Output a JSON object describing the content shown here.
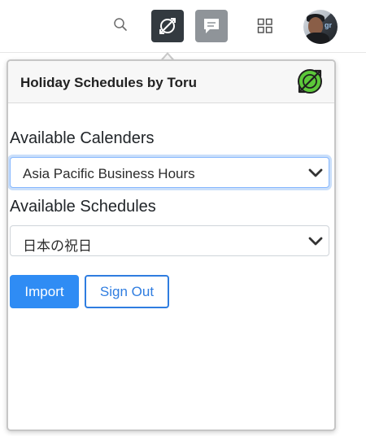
{
  "topbar": {
    "icons": {
      "search": "search-icon",
      "sync": "sync-icon",
      "chat": "chat-icon",
      "grid": "grid-icon"
    },
    "avatar_badge": "gr"
  },
  "popover": {
    "title": "Holiday Schedules by Toru",
    "logo_icon": "holiday-schedules-logo-icon",
    "calendars": {
      "label": "Available Calenders",
      "selected": "Asia Pacific Business Hours"
    },
    "schedules": {
      "label": "Available Schedules",
      "selected": "日本の祝日"
    },
    "buttons": {
      "import": "Import",
      "sign_out": "Sign Out"
    }
  },
  "colors": {
    "primary": "#2f8cf4",
    "outline": "#2f7de0",
    "focus_ring": "#86b7fe",
    "sync_active_bg": "#333a40",
    "chat_bg": "#8f9499",
    "logo_green": "#5cc83a"
  }
}
